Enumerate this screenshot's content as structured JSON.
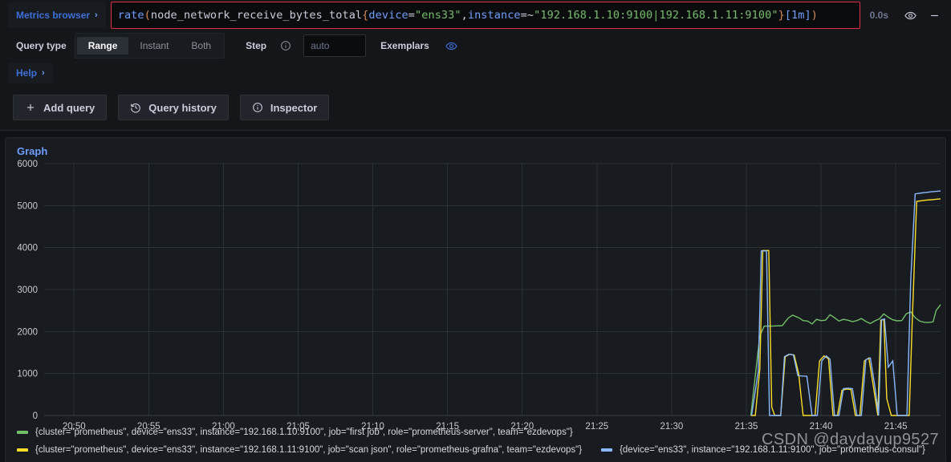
{
  "query_editor": {
    "metrics_browser_label": "Metrics browser",
    "metrics_browser_chevron": "›",
    "expression": "rate(node_network_receive_bytes_total{device=\"ens33\",instance=~\"192.168.1.10:9100|192.168.1.11:9100\"}[1m])",
    "expression_tokens": {
      "fn": "rate",
      "open_paren": "(",
      "metric": "node_network_receive_bytes_total",
      "open_brace": "{",
      "label1": "device",
      "eq1": "=",
      "value1": "\"ens33\"",
      "comma": ",",
      "label2": "instance",
      "eq2": "=~",
      "value2": "\"192.168.1.10:9100|192.168.1.11:9100\"",
      "close_brace": "}",
      "range": "[1m]",
      "close_paren": ")"
    },
    "duration": "0.0s",
    "eye_icon": "eye-icon",
    "collapse_icon": "minus-icon",
    "border_color": "#e02f44"
  },
  "options": {
    "query_type_label": "Query type",
    "query_types": [
      {
        "label": "Range",
        "active": true
      },
      {
        "label": "Instant",
        "active": false
      },
      {
        "label": "Both",
        "active": false
      }
    ],
    "step_label": "Step",
    "step_info_icon": "info-circle-icon",
    "step_value": "",
    "step_placeholder": "auto",
    "exemplars_label": "Exemplars",
    "exemplars_icon": "eye-icon"
  },
  "help": {
    "label": "Help",
    "chevron": "›"
  },
  "actions": [
    {
      "label": "Add query",
      "icon": "plus-icon"
    },
    {
      "label": "Query history",
      "icon": "history-icon"
    },
    {
      "label": "Inspector",
      "icon": "info-circle-icon"
    }
  ],
  "panel": {
    "title": "Graph"
  },
  "watermark": "CSDN @daydayup9527",
  "chart_data": {
    "type": "line",
    "title": "Graph",
    "xlabel": "",
    "ylabel": "",
    "ylim": [
      0,
      6000
    ],
    "yticks": [
      0,
      1000,
      2000,
      3000,
      4000,
      5000,
      6000
    ],
    "ytick_labels": [
      "0",
      "1000",
      "2000",
      "3000",
      "4000",
      "5000",
      "6000"
    ],
    "xtick_labels": [
      "20:50",
      "20:55",
      "21:00",
      "21:05",
      "21:10",
      "21:15",
      "21:20",
      "21:25",
      "21:30",
      "21:35",
      "21:40",
      "21:45"
    ],
    "xlim_minutes": [
      1248,
      1308
    ],
    "grid": true,
    "legend_position": "bottom",
    "series": [
      {
        "name": "{cluster=\"prometheus\", device=\"ens33\", instance=\"192.168.1.10:9100\", job=\"first job\", role=\"prometheus-server\", team=\"ezdevops\"}",
        "color": "#73bf69",
        "points": [
          [
            1295.3,
            0
          ],
          [
            1295.9,
            1900
          ],
          [
            1296.2,
            2130
          ],
          [
            1296.6,
            2130
          ],
          [
            1297.0,
            2135
          ],
          [
            1297.4,
            2140
          ],
          [
            1297.8,
            2320
          ],
          [
            1298.1,
            2390
          ],
          [
            1298.5,
            2330
          ],
          [
            1298.8,
            2260
          ],
          [
            1299.1,
            2250
          ],
          [
            1299.4,
            2180
          ],
          [
            1299.7,
            2290
          ],
          [
            1300.0,
            2260
          ],
          [
            1300.3,
            2270
          ],
          [
            1300.6,
            2400
          ],
          [
            1300.9,
            2330
          ],
          [
            1301.2,
            2250
          ],
          [
            1301.5,
            2290
          ],
          [
            1301.8,
            2270
          ],
          [
            1302.1,
            2235
          ],
          [
            1302.4,
            2260
          ],
          [
            1302.7,
            2310
          ],
          [
            1303.0,
            2240
          ],
          [
            1303.3,
            2190
          ],
          [
            1303.6,
            2255
          ],
          [
            1303.9,
            2300
          ],
          [
            1304.2,
            2420
          ],
          [
            1304.5,
            2340
          ],
          [
            1304.8,
            2280
          ],
          [
            1305.1,
            2255
          ],
          [
            1305.4,
            2260
          ],
          [
            1305.7,
            2420
          ],
          [
            1306.0,
            2470
          ],
          [
            1306.3,
            2330
          ],
          [
            1306.6,
            2250
          ],
          [
            1306.9,
            2220
          ],
          [
            1307.2,
            2215
          ],
          [
            1307.5,
            2230
          ],
          [
            1307.7,
            2500
          ],
          [
            1308.0,
            2640
          ]
        ]
      },
      {
        "name": "{cluster=\"prometheus\", device=\"ens33\", instance=\"192.168.1.11:9100\", job=\"scan json\", role=\"prometheus-grafna\", team=\"ezdevops\"}",
        "color": "#fade2a",
        "points": [
          [
            1295.3,
            0
          ],
          [
            1295.6,
            0
          ],
          [
            1295.9,
            1100
          ],
          [
            1296.1,
            3930
          ],
          [
            1296.5,
            3930
          ],
          [
            1296.7,
            200
          ],
          [
            1296.9,
            0
          ],
          [
            1297.3,
            0
          ],
          [
            1297.6,
            1400
          ],
          [
            1297.9,
            1460
          ],
          [
            1298.2,
            1440
          ],
          [
            1298.5,
            1000
          ],
          [
            1298.8,
            0
          ],
          [
            1299.2,
            0
          ],
          [
            1299.6,
            0
          ],
          [
            1299.9,
            1300
          ],
          [
            1300.2,
            1420
          ],
          [
            1300.5,
            1350
          ],
          [
            1300.8,
            0
          ],
          [
            1301.1,
            0
          ],
          [
            1301.4,
            600
          ],
          [
            1301.7,
            630
          ],
          [
            1302.0,
            620
          ],
          [
            1302.3,
            0
          ],
          [
            1302.6,
            0
          ],
          [
            1302.9,
            1300
          ],
          [
            1303.2,
            1370
          ],
          [
            1303.5,
            700
          ],
          [
            1303.8,
            0
          ],
          [
            1304.0,
            2270
          ],
          [
            1304.2,
            2290
          ],
          [
            1304.4,
            400
          ],
          [
            1304.7,
            0
          ],
          [
            1305.0,
            0
          ],
          [
            1305.3,
            0
          ],
          [
            1305.6,
            0
          ],
          [
            1305.9,
            0
          ],
          [
            1306.1,
            2200
          ],
          [
            1306.4,
            5100
          ],
          [
            1306.8,
            5120
          ],
          [
            1307.0,
            5130
          ],
          [
            1307.4,
            5140
          ],
          [
            1307.7,
            5150
          ],
          [
            1308.0,
            5160
          ]
        ]
      },
      {
        "name": "{device=\"ens33\", instance=\"192.168.1.11:9100\", job=\"prometheus-consul\"}",
        "color": "#8ab8ff",
        "points": [
          [
            1295.35,
            0
          ],
          [
            1295.8,
            1050
          ],
          [
            1296.0,
            3920
          ],
          [
            1296.35,
            3920
          ],
          [
            1296.55,
            0
          ],
          [
            1296.9,
            0
          ],
          [
            1297.3,
            0
          ],
          [
            1297.55,
            1400
          ],
          [
            1297.85,
            1460
          ],
          [
            1298.15,
            1440
          ],
          [
            1298.45,
            950
          ],
          [
            1298.75,
            940
          ],
          [
            1299.05,
            935
          ],
          [
            1299.4,
            0
          ],
          [
            1299.75,
            0
          ],
          [
            1300.05,
            1300
          ],
          [
            1300.35,
            1420
          ],
          [
            1300.6,
            1340
          ],
          [
            1300.9,
            0
          ],
          [
            1301.2,
            0
          ],
          [
            1301.5,
            640
          ],
          [
            1301.8,
            650
          ],
          [
            1302.1,
            640
          ],
          [
            1302.4,
            0
          ],
          [
            1302.7,
            0
          ],
          [
            1303.0,
            1330
          ],
          [
            1303.3,
            1370
          ],
          [
            1303.6,
            700
          ],
          [
            1303.85,
            0
          ],
          [
            1304.05,
            2280
          ],
          [
            1304.25,
            2300
          ],
          [
            1304.5,
            1150
          ],
          [
            1304.8,
            1300
          ],
          [
            1305.1,
            0
          ],
          [
            1305.45,
            0
          ],
          [
            1305.75,
            0
          ],
          [
            1306.0,
            3200
          ],
          [
            1306.3,
            5280
          ],
          [
            1306.7,
            5300
          ],
          [
            1307.0,
            5310
          ],
          [
            1307.4,
            5330
          ],
          [
            1307.7,
            5340
          ],
          [
            1308.0,
            5350
          ]
        ]
      }
    ]
  }
}
